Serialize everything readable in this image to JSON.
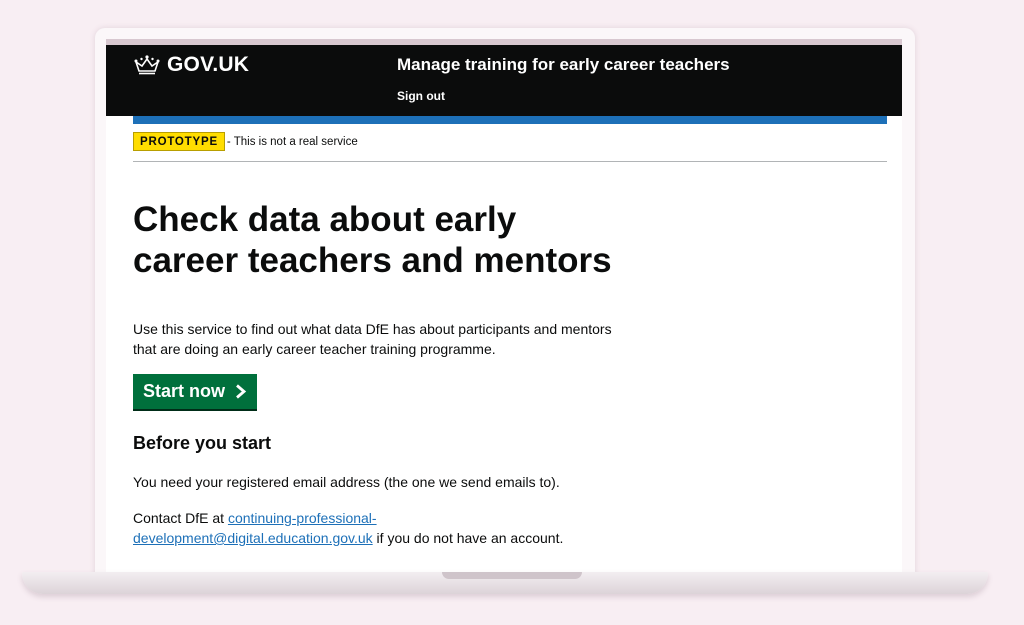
{
  "header": {
    "logotype": "GOV.UK",
    "service_name": "Manage training for early career teachers",
    "sign_out_label": "Sign out"
  },
  "phase_banner": {
    "tag": "PROTOTYPE",
    "text": "- This is not a real service"
  },
  "main": {
    "title_line1": "Check data about early",
    "title_line2": "career teachers and mentors",
    "lede_line1": "Use this service to find out what data DfE has about participants and mentors",
    "lede_line2": "that are doing an early career teacher training programme.",
    "start_button_label": "Start now",
    "before_heading": "Before you start",
    "before_text": "You need your registered email address (the one we send emails to).",
    "contact_prefix": "Contact DfE at ",
    "contact_link_line1": "continuing-professional-",
    "contact_link_line2": "development@digital.education.gov.uk",
    "contact_suffix": " if you do not have an account."
  },
  "colors": {
    "header_bg": "#0b0c0c",
    "brand_blue": "#1d70b8",
    "tag_yellow": "#ffdd00",
    "button_green": "#00703c",
    "page_bg": "#f8eef3"
  },
  "icons": {
    "logo": "crown-icon",
    "start_button": "chevron-right-icon"
  }
}
